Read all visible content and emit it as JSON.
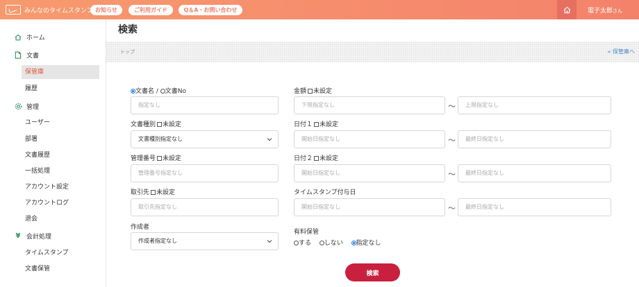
{
  "header": {
    "app_name": "みんなのタイムスタンプ",
    "pills": [
      "お知らせ",
      "ご利用ガイド",
      "Q＆A・お問い合わせ"
    ],
    "user_name": "電子太郎",
    "user_suffix": "さん"
  },
  "sidebar": {
    "home": "ホーム",
    "documents": "文書",
    "doc_items": [
      "保管庫",
      "履歴"
    ],
    "admin": "管理",
    "admin_items": [
      "ユーザー",
      "部署",
      "文書履歴",
      "一括処理",
      "アカウント設定",
      "アカウントログ",
      "退会"
    ],
    "accounting": "会計処理",
    "accounting_items": [
      "タイムスタンプ",
      "文書保管"
    ]
  },
  "page": {
    "title": "検索",
    "breadcrumb": "トップ",
    "back_link": "«  保管庫へ"
  },
  "form": {
    "docname_radio_a": "文書名",
    "docname_sep": " / ",
    "docname_radio_b": "文書No",
    "docname_placeholder": "指定なし",
    "doctype_label": "文書種別",
    "unset": "未設定",
    "doctype_value": "文書種別指定なし",
    "mgmt_label": "管理番号",
    "mgmt_placeholder": "管理番号指定なし",
    "client_label": "取引先",
    "client_placeholder": "取引先指定なし",
    "creator_label": "作成者",
    "creator_value": "作成者指定なし",
    "amount_label": "金額",
    "amount_min": "下限指定なし",
    "amount_max": "上限指定なし",
    "date1_label": "日付１",
    "date2_label": "日付２",
    "ts_label": "タイムスタンプ付与日",
    "date_start": "開始日指定なし",
    "date_end": "最終日指定なし",
    "tilde": "～",
    "paid_label": "有料保管",
    "paid_options": [
      "する",
      "しない",
      "指定なし"
    ],
    "search_button": "検索"
  },
  "colors": {
    "header": "#f4826b",
    "accent": "#c8203e",
    "link": "#4a86c7",
    "active": "#e05a3a"
  }
}
